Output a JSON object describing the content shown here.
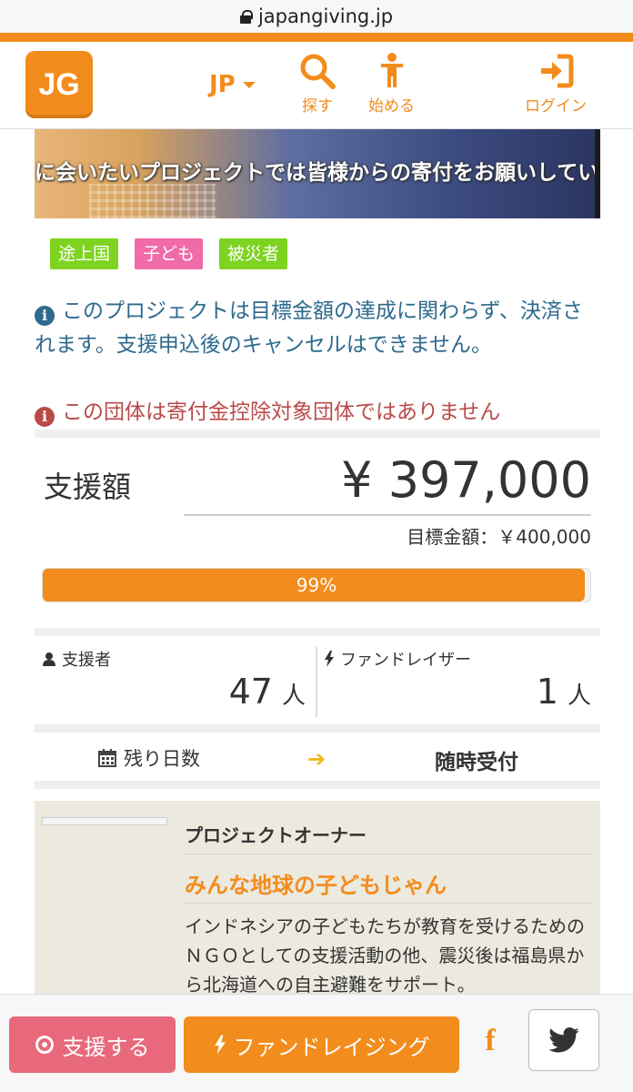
{
  "browser": {
    "url": "japangiving.jp"
  },
  "header": {
    "logo_text": "JG",
    "lang_label": "JP",
    "nav": {
      "search_label": "探す",
      "start_label": "始める",
      "login_label": "ログイン"
    }
  },
  "hero": {
    "caption": "に会いたいプロジェクトでは皆様からの寄付をお願いしてい"
  },
  "tags": [
    {
      "label": "途上国",
      "color": "#7ed321"
    },
    {
      "label": "子ども",
      "color": "#f06ba8"
    },
    {
      "label": "被災者",
      "color": "#7ed321"
    }
  ],
  "notices": {
    "info": "このプロジェクトは目標金額の達成に関わらず、決済されます。支援申込後のキャンセルはできません。",
    "warning": "この団体は寄付金控除対象団体ではありません"
  },
  "funding": {
    "raised_label": "支援額",
    "raised_amount": "¥ 397,000",
    "goal_text": "目標金額：￥400,000",
    "progress_percent": 99,
    "progress_label": "99%"
  },
  "stats": {
    "supporters_label": "支援者",
    "supporters_count": "47",
    "supporters_unit": "人",
    "fundraisers_label": "ファンドレイザー",
    "fundraisers_count": "1",
    "fundraisers_unit": "人",
    "days_left_label": "残り日数",
    "days_left_value": "随時受付"
  },
  "owner": {
    "section_title": "プロジェクトオーナー",
    "name": "みんな地球の子どもじゃん",
    "description": "インドネシアの子どもたちが教育を受けるためのＮＧＯとしての支援活動の他、震災後は福島県から北海道への自主避難をサポート。"
  },
  "bottom_bar": {
    "support_button": "支援する",
    "fundraise_button": "ファンドレイジング",
    "facebook_icon_text": "f"
  },
  "colors": {
    "brand_orange": "#f28c1c",
    "info_blue": "#2d6a8d",
    "warning_red": "#b94a48",
    "support_pink": "#e8697b"
  }
}
